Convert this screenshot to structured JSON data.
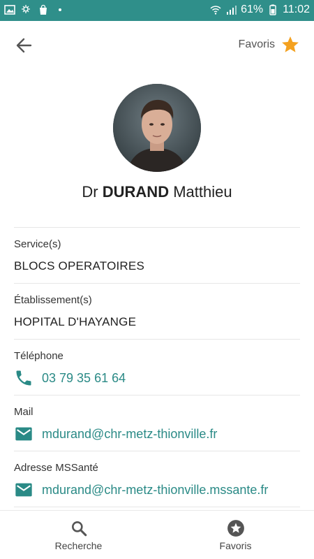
{
  "status_bar": {
    "battery": "61%",
    "time": "11:02"
  },
  "top_bar": {
    "favorites_label": "Favoris"
  },
  "profile": {
    "title": "Dr",
    "last_name": "DURAND",
    "first_name": "Matthieu"
  },
  "sections": {
    "service_label": "Service(s)",
    "service_value": "BLOCS OPERATOIRES",
    "establishment_label": "Établissement(s)",
    "establishment_value": "HOPITAL D'HAYANGE",
    "phone_label": "Téléphone",
    "phone_value": "03 79 35 61 64",
    "mail_label": "Mail",
    "mail_value": "mdurand@chr-metz-thionville.fr",
    "mss_label": "Adresse MSSanté",
    "mss_value": "mdurand@chr-metz-thionville.mssante.fr"
  },
  "bottom_nav": {
    "search_label": "Recherche",
    "favorites_label": "Favoris"
  },
  "colors": {
    "accent": "#2a8a86",
    "status_bar": "#2f8f8a",
    "star": "#f4a11f"
  },
  "icons": {
    "back": "arrow-left-icon",
    "favorite": "star-icon",
    "phone": "phone-icon",
    "mail": "mail-icon",
    "search": "search-icon",
    "favorites_nav": "star-circle-icon"
  }
}
